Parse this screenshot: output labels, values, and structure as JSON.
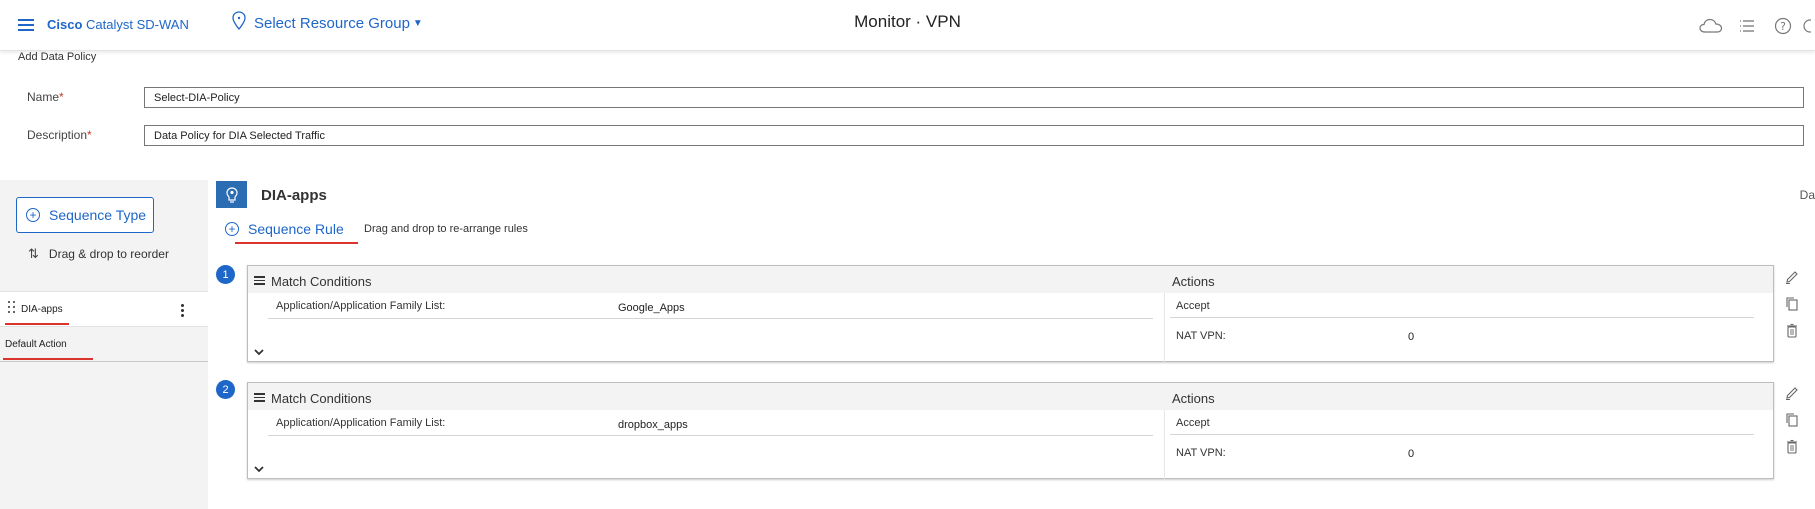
{
  "header": {
    "brand_bold": "Cisco",
    "brand_rest": "Catalyst SD-WAN",
    "resource_group": "Select Resource Group",
    "title": "Monitor · VPN"
  },
  "form": {
    "title": "Add Data Policy",
    "name_label": "Name",
    "name_value": "Select-DIA-Policy",
    "description_label": "Description",
    "description_value": "Data Policy for DIA Selected Traffic",
    "required_mark": "*"
  },
  "sidebar": {
    "sequence_type_label": "Sequence Type",
    "drag_reorder_label": "Drag & drop to reorder",
    "items": [
      {
        "label": "DIA-apps"
      }
    ],
    "default_action_label": "Default Action"
  },
  "sequence": {
    "name": "DIA-apps",
    "right_edge_text": "Da",
    "rule_button_label": "Sequence Rule",
    "rule_hint": "Drag and drop to re-arrange rules"
  },
  "rules": [
    {
      "number": "1",
      "match_title": "Match Conditions",
      "actions_title": "Actions",
      "match_label": "Application/Application Family List:",
      "match_value": "Google_Apps",
      "action": "Accept",
      "nat_label": "NAT VPN:",
      "nat_value": "0"
    },
    {
      "number": "2",
      "match_title": "Match Conditions",
      "actions_title": "Actions",
      "match_label": "Application/Application Family List:",
      "match_value": "dropbox_apps",
      "action": "Accept",
      "nat_label": "NAT VPN:",
      "nat_value": "0"
    }
  ],
  "colors": {
    "accent": "#1e66c8",
    "underline_red": "#d9352c",
    "sequence_icon_bg": "#2a6db3"
  },
  "icons": {
    "menu": "hamburger-icon",
    "location": "location-pin-icon",
    "cloud": "cloud-icon",
    "list": "list-icon",
    "help": "help-icon",
    "edit": "pencil-icon",
    "copy": "copy-icon",
    "delete": "trash-icon"
  }
}
